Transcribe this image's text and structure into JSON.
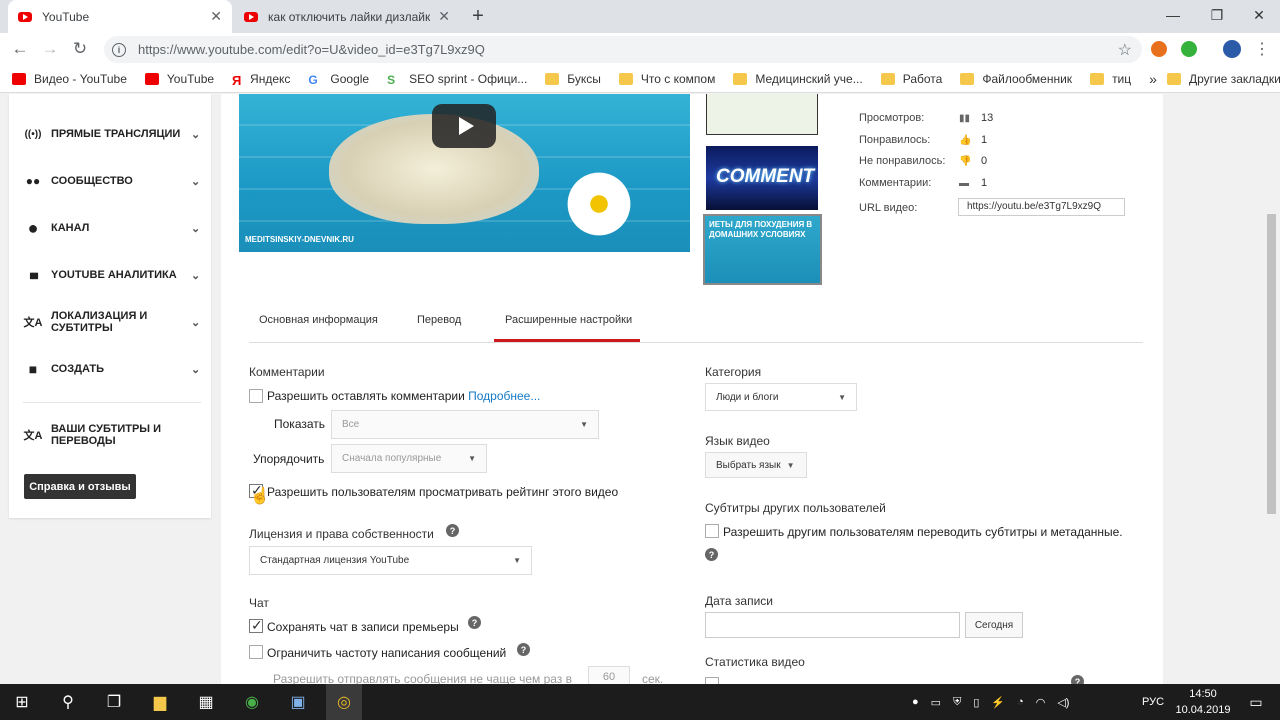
{
  "browser": {
    "tabs": [
      {
        "title": "YouTube",
        "close": "✕"
      },
      {
        "title": "как отключить лайки дизлайк",
        "close": "✕"
      }
    ],
    "new_tab": "+",
    "window_controls": {
      "minimize": "—",
      "maximize": "❐",
      "close": "✕"
    },
    "url": "https://www.youtube.com/edit?o=U&video_id=e3Tg7L9xz9Q",
    "info_icon": "i",
    "star": "☆",
    "bookmarks": [
      {
        "label": "Видео - YouTube",
        "icon": "youtube-icon"
      },
      {
        "label": "YouTube",
        "icon": "youtube-icon"
      },
      {
        "label": "Яндекс",
        "icon": "yandex-icon",
        "glyph": "Я"
      },
      {
        "label": "Google",
        "icon": "google-icon",
        "glyph": "G"
      },
      {
        "label": "SEO sprint - Офици...",
        "icon": "seo-icon",
        "glyph": "S"
      },
      {
        "label": "Буксы",
        "icon": "folder-icon"
      },
      {
        "label": "Что с компом",
        "icon": "folder-icon"
      },
      {
        "label": "Медицинский уче...",
        "icon": "folder-icon"
      },
      {
        "label": "Работа",
        "icon": "folder-icon"
      },
      {
        "label": "Файлообменник",
        "icon": "folder-icon"
      },
      {
        "label": "тиц",
        "icon": "folder-icon"
      }
    ],
    "more_bookmarks": "»",
    "other_bookmarks": "Другие закладки"
  },
  "sidebar": {
    "items": [
      {
        "label": "ПРЯМЫЕ ТРАНСЛЯЦИИ",
        "icon": "live-icon",
        "glyph": "((•))"
      },
      {
        "label": "СООБЩЕСТВО",
        "icon": "community-icon",
        "glyph": "👥"
      },
      {
        "label": "КАНАЛ",
        "icon": "channel-icon",
        "glyph": "●"
      },
      {
        "label": "YOUTUBE АНАЛИТИКА",
        "icon": "analytics-icon",
        "glyph": "▮▮▮"
      },
      {
        "label": "ЛОКАЛИЗАЦИЯ И СУБТИТРЫ",
        "icon": "translate-icon",
        "glyph": "文A"
      },
      {
        "label": "СОЗДАТЬ",
        "icon": "create-icon",
        "glyph": "■"
      }
    ],
    "subs": {
      "label": "ВАШИ СУБТИТРЫ И ПЕРЕВОДЫ",
      "glyph": "文A"
    },
    "help_button": "Справка и отзывы"
  },
  "video": {
    "watermark": "MEDITSINSKIY-DNEVNIK.RU",
    "thumb2_text": "COMMENT",
    "thumb3_text": "ИЕТЫ ДЛЯ ПОХУДЕНИЯ В ДОМАШНИХ УСЛОВИЯХ"
  },
  "stats": {
    "views_label": "Просмотров:",
    "views": "13",
    "likes_label": "Понравилось:",
    "likes": "1",
    "dislikes_label": "Не понравилось:",
    "dislikes": "0",
    "comments_label": "Комментарии:",
    "comments": "1",
    "url_label": "URL видео:",
    "url": "https://youtu.be/e3Tg7L9xz9Q"
  },
  "tabs": {
    "basic": "Основная информация",
    "translation": "Перевод",
    "advanced": "Расширенные настройки"
  },
  "comments": {
    "heading": "Комментарии",
    "allow": "Разрешить оставлять комментарии",
    "more": "Подробнее...",
    "show_label": "Показать",
    "show_value": "Все",
    "sort_label": "Упорядочить",
    "sort_value": "Сначала популярные",
    "rating": "Разрешить пользователям просматривать рейтинг этого видео"
  },
  "license": {
    "heading": "Лицензия и права собственности",
    "value": "Стандартная лицензия YouTube"
  },
  "chat": {
    "heading": "Чат",
    "save": "Сохранять чат в записи премьеры",
    "limit": "Ограничить частоту написания сообщений",
    "limit_detail": "Разрешить отправлять сообщения не чаще чем раз в",
    "limit_value": "60",
    "limit_unit": "сек."
  },
  "right": {
    "category_heading": "Категория",
    "category_value": "Люди и блоги",
    "language_heading": "Язык видео",
    "language_value": "Выбрать язык",
    "subs_heading": "Субтитры других пользователей",
    "subs_allow": "Разрешить другим пользователям переводить субтитры и метаданные.",
    "date_heading": "Дата записи",
    "today": "Сегодня",
    "stats_heading": "Статистика видео"
  },
  "taskbar": {
    "lang": "РУС",
    "time": "14:50",
    "date": "10.04.2019"
  }
}
